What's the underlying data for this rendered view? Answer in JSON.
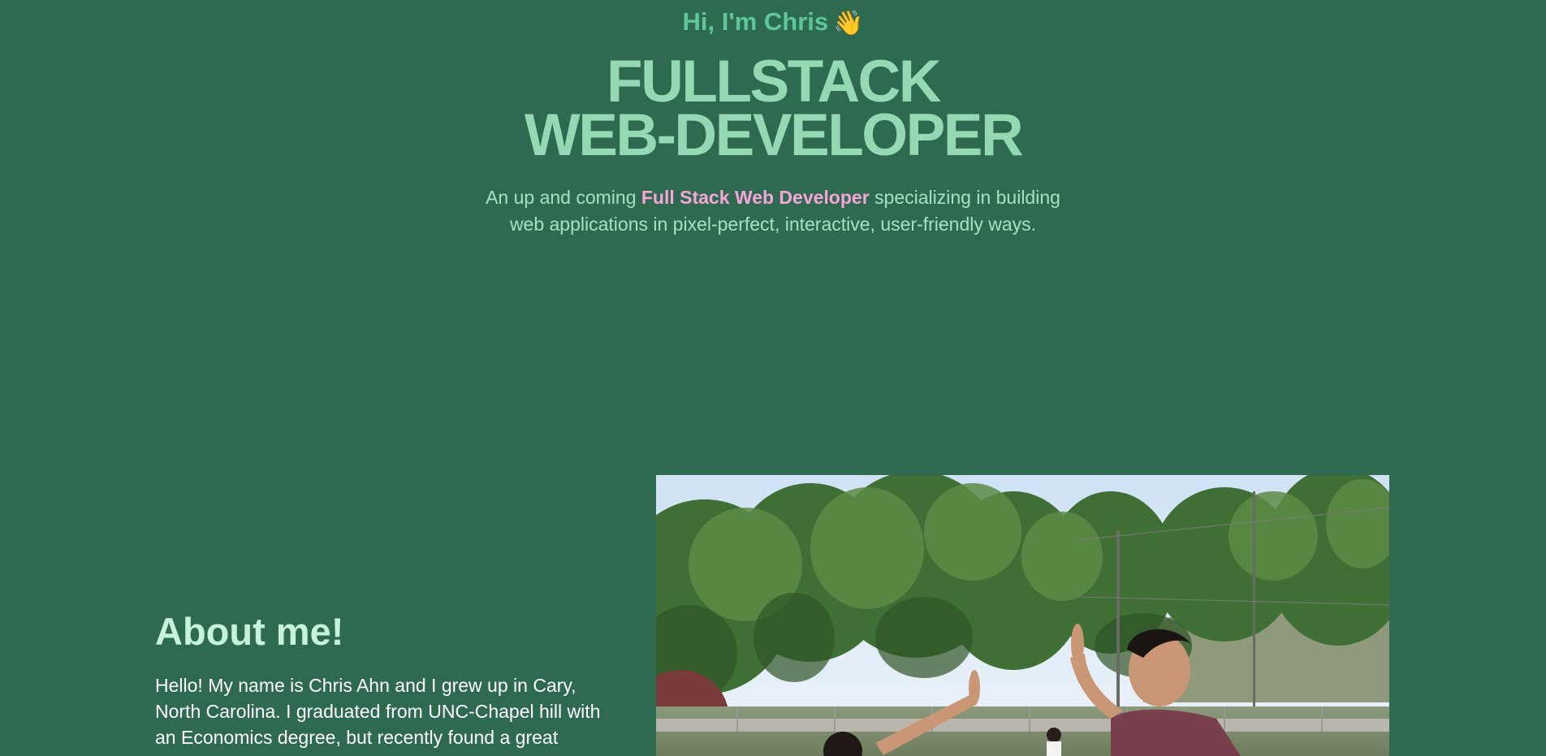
{
  "hero": {
    "greeting": "Hi, I'm Chris",
    "wave_emoji": "👋",
    "title_line1": "FULLSTACK",
    "title_line2": "WEB-DEVELOPER",
    "subtitle_before": "An up and coming ",
    "subtitle_highlight": "Full Stack Web Developer",
    "subtitle_after": " specializing in building web applications in pixel-perfect, interactive, user-friendly ways."
  },
  "about": {
    "heading": "About me!",
    "body": "Hello! My name is Chris Ahn and I grew up in Cary, North Carolina. I graduated from UNC-Chapel hill with an Economics degree, but recently found a great passion and"
  },
  "photo": {
    "subject": "outdoor-high-five-photo"
  },
  "colors": {
    "background": "#2e6a50",
    "greeting": "#5ec79a",
    "title": "#94d8b4",
    "subtitle": "#a7e0c2",
    "highlight": "#f7a5d9",
    "about_heading": "#c7f3da",
    "about_body": "#ffffff"
  }
}
